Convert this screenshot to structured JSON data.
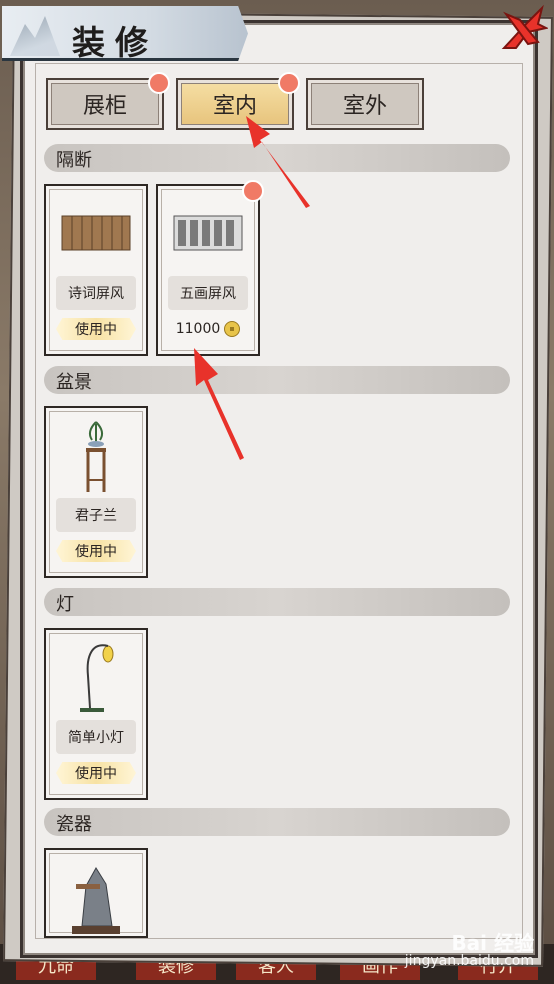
{
  "header": {
    "title": "装修"
  },
  "tabs": [
    {
      "label": "展柜",
      "active": false,
      "badge": true
    },
    {
      "label": "室内",
      "active": true,
      "badge": true
    },
    {
      "label": "室外",
      "active": false,
      "badge": false
    }
  ],
  "sections": [
    {
      "title": "隔断",
      "items": [
        {
          "name": "诗词屏风",
          "status": "使用中"
        },
        {
          "name": "五画屏风",
          "price": "11000",
          "badge": true
        }
      ]
    },
    {
      "title": "盆景",
      "items": [
        {
          "name": "君子兰",
          "status": "使用中"
        }
      ]
    },
    {
      "title": "灯",
      "items": [
        {
          "name": "简单小灯",
          "status": "使用中"
        }
      ]
    },
    {
      "title": "瓷器",
      "items": [
        {}
      ]
    }
  ],
  "bottom_bar": [
    "九命",
    "装修",
    "客人",
    "画作",
    "行介"
  ],
  "watermark": {
    "brand": "Bai 经验",
    "url": "jingyan.baidu.com"
  },
  "colors": {
    "accent_red": "#e8322a",
    "active_tab": "#f0d08a",
    "badge": "#f07a66"
  },
  "icons": [
    "close-icon",
    "coin-icon",
    "arrow-indicator-icon"
  ]
}
